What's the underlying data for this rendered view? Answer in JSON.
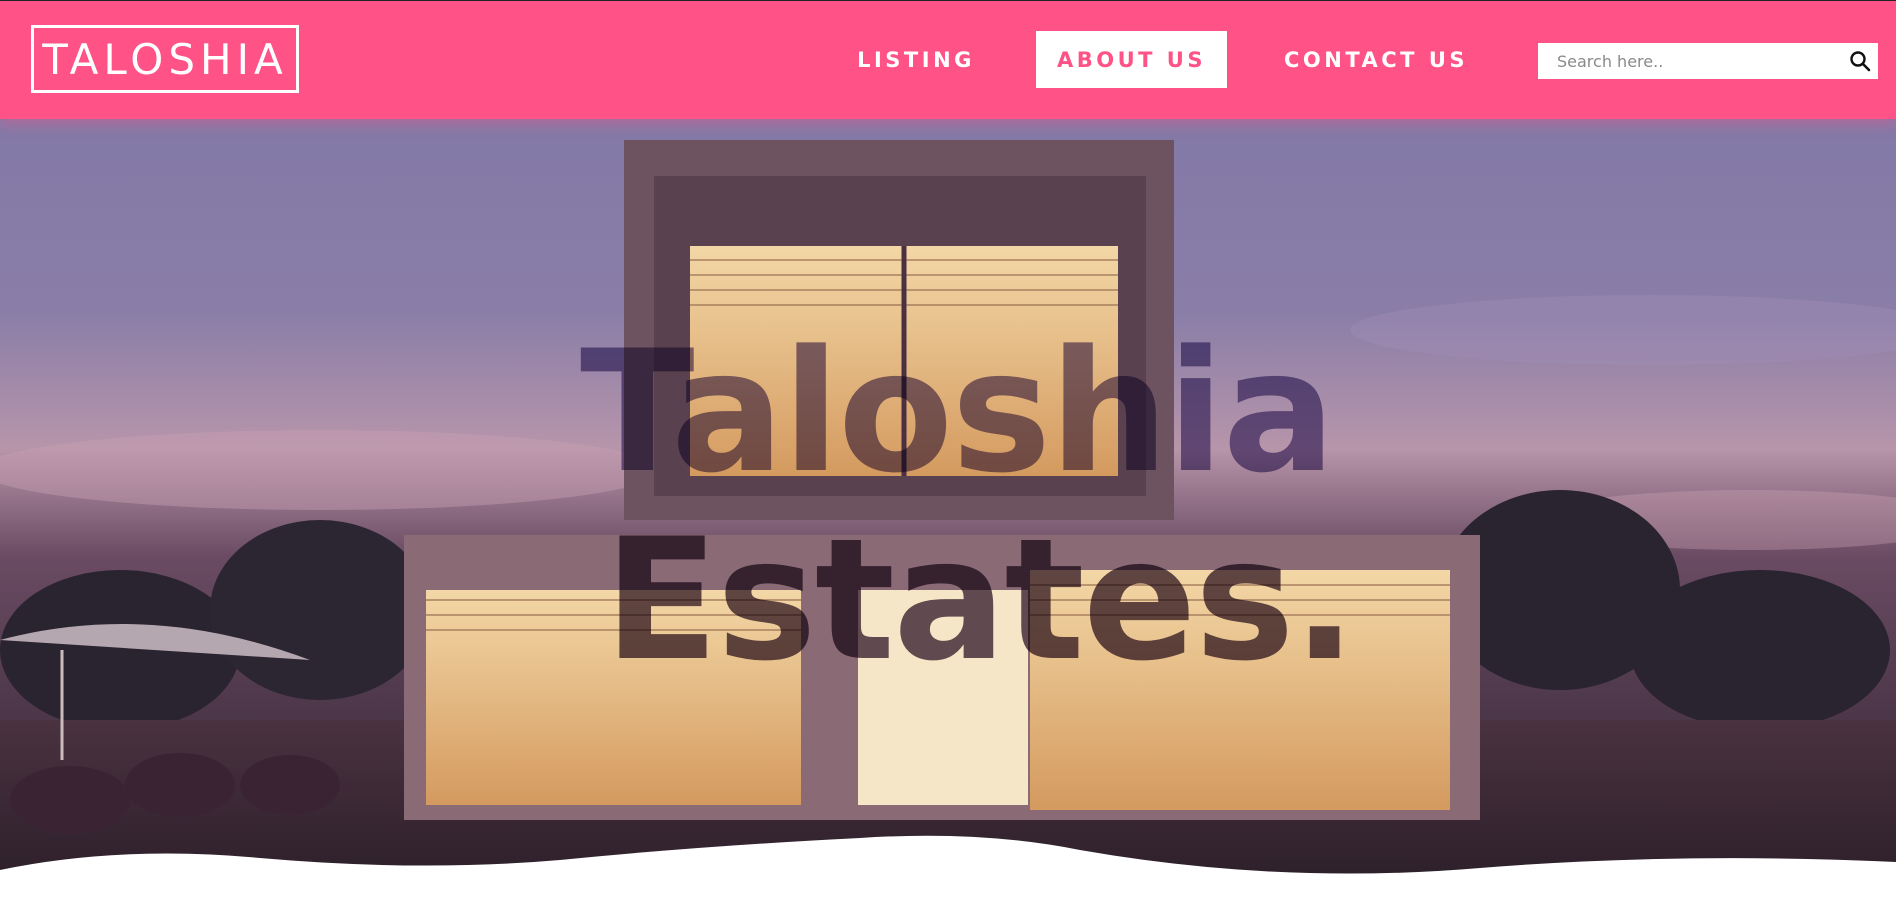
{
  "brand": {
    "logo_text": "TALOSHIA"
  },
  "nav": {
    "items": [
      {
        "label": "LISTING",
        "active": false
      },
      {
        "label": "ABOUT US",
        "active": true
      },
      {
        "label": "CONTACT US",
        "active": false
      }
    ]
  },
  "search": {
    "placeholder": "Search here..",
    "value": ""
  },
  "hero": {
    "title_line1": "Taloshia",
    "title_line2": "Estates."
  },
  "colors": {
    "accent": "#ff5286",
    "nav_text": "#ffffff",
    "active_bg": "#ffffff",
    "active_text": "#ff5286"
  },
  "icons": {
    "search": "search-icon"
  }
}
